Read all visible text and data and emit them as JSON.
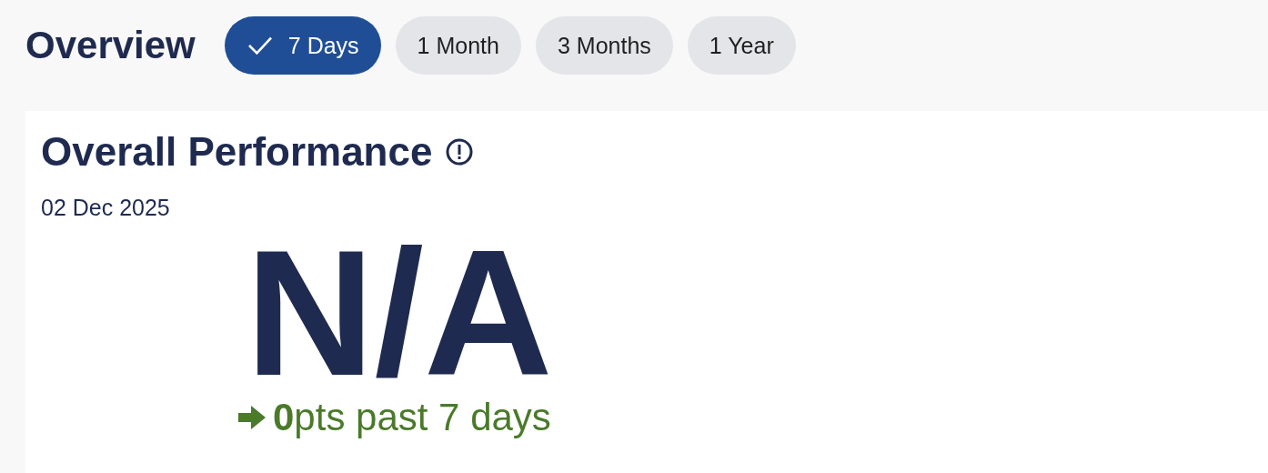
{
  "header": {
    "title": "Overview"
  },
  "periods": [
    {
      "label": "7 Days",
      "selected": true
    },
    {
      "label": "1 Month",
      "selected": false
    },
    {
      "label": "3 Months",
      "selected": false
    },
    {
      "label": "1 Year",
      "selected": false
    }
  ],
  "card": {
    "title": "Overall Performance",
    "date": "02 Dec 2025",
    "score": "N/A",
    "change": "**0**pts past 7 days"
  }
}
